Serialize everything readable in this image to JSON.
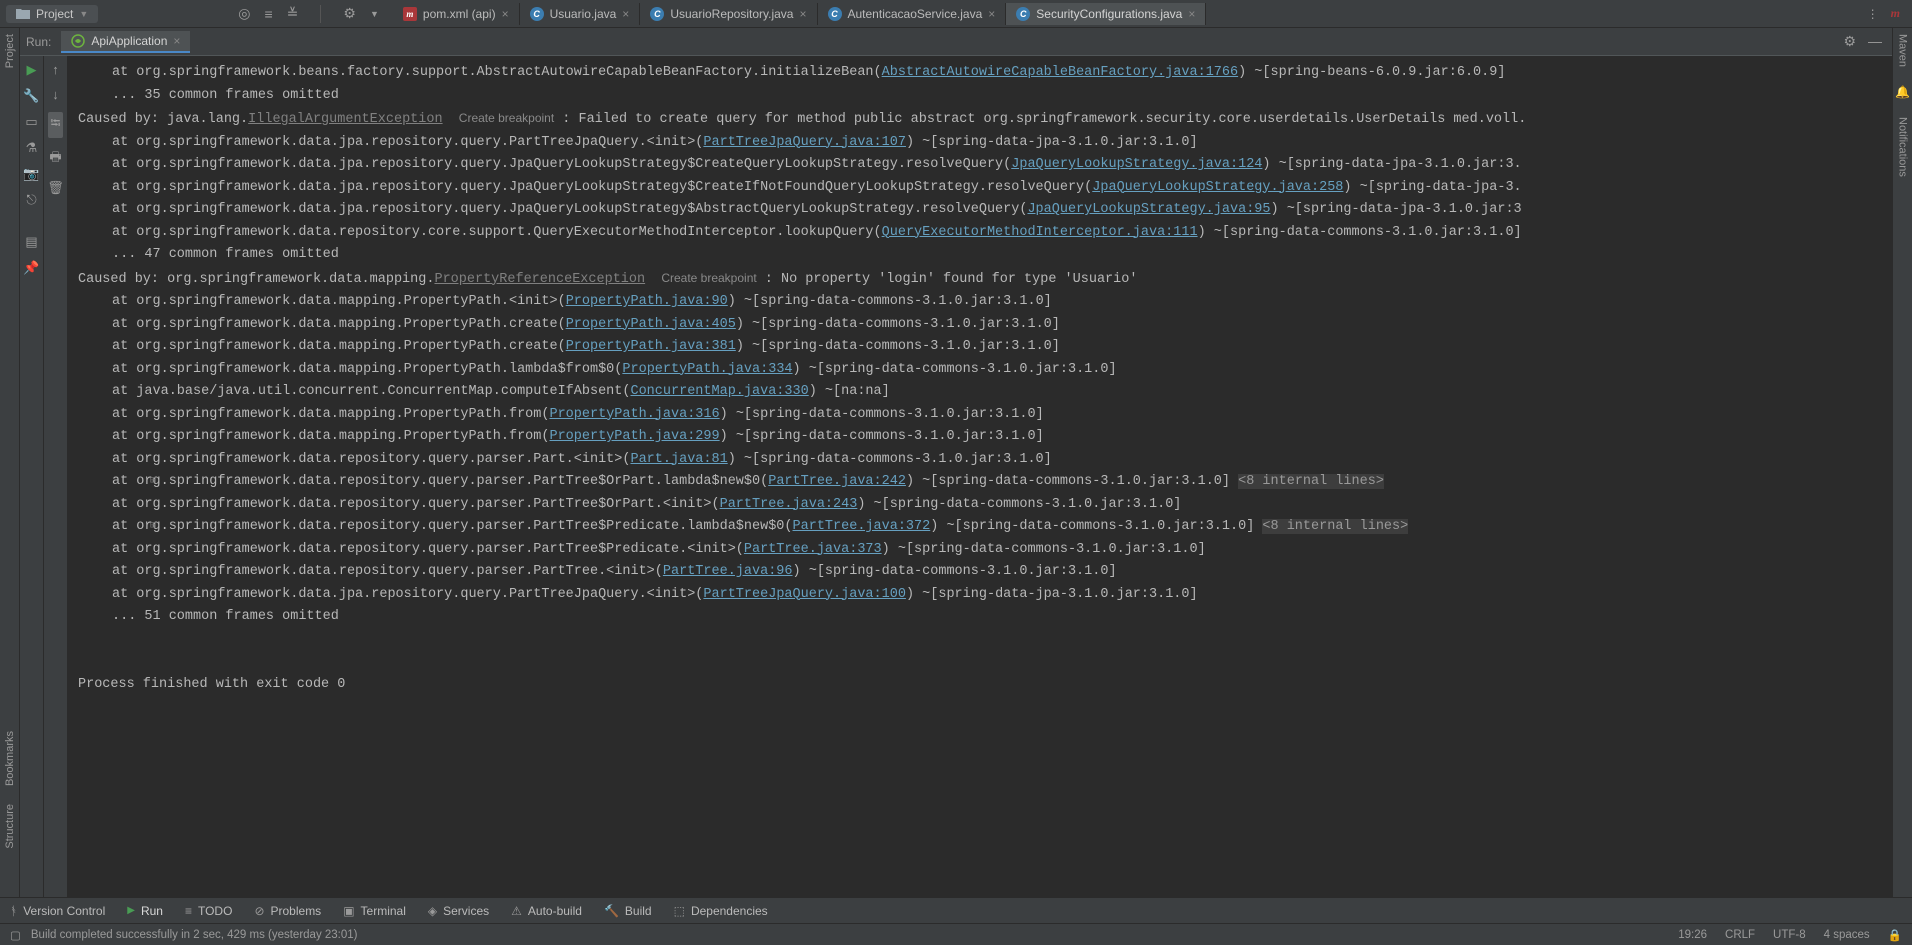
{
  "topbar": {
    "project_label": "Project"
  },
  "editor_tabs": [
    {
      "label": "pom.xml (api)",
      "icon": "m"
    },
    {
      "label": "Usuario.java",
      "icon": "c"
    },
    {
      "label": "UsuarioRepository.java",
      "icon": "c"
    },
    {
      "label": "AutenticacaoService.java",
      "icon": "c"
    },
    {
      "label": "SecurityConfigurations.java",
      "icon": "c",
      "active": true
    }
  ],
  "left_tool": [
    "Project"
  ],
  "left_tool_bottom": [
    "Bookmarks",
    "Structure"
  ],
  "right_tool": [
    "Maven",
    "Notifications"
  ],
  "run": {
    "label": "Run:",
    "tab": "ApiApplication"
  },
  "console_lines": [
    {
      "t": "at",
      "pre": "at org.springframework.beans.factory.support.AbstractAutowireCapableBeanFactory.initializeBean(",
      "link": "AbstractAutowireCapableBeanFactory.java:1766",
      "post": ") ~[spring-beans-6.0.9.jar:6.0.9]"
    },
    {
      "t": "dots",
      "text": "... 35 common frames omitted"
    },
    {
      "t": "caused",
      "pre": "Caused by: java.lang.",
      "ex": "IllegalArgumentException",
      "bp": "Create breakpoint",
      "post": " : Failed to create query for method public abstract org.springframework.security.core.userdetails.UserDetails med.voll."
    },
    {
      "t": "at",
      "pre": "at org.springframework.data.jpa.repository.query.PartTreeJpaQuery.<init>(",
      "link": "PartTreeJpaQuery.java:107",
      "post": ") ~[spring-data-jpa-3.1.0.jar:3.1.0]"
    },
    {
      "t": "at",
      "pre": "at org.springframework.data.jpa.repository.query.JpaQueryLookupStrategy$CreateQueryLookupStrategy.resolveQuery(",
      "link": "JpaQueryLookupStrategy.java:124",
      "post": ") ~[spring-data-jpa-3.1.0.jar:3."
    },
    {
      "t": "at",
      "pre": "at org.springframework.data.jpa.repository.query.JpaQueryLookupStrategy$CreateIfNotFoundQueryLookupStrategy.resolveQuery(",
      "link": "JpaQueryLookupStrategy.java:258",
      "post": ") ~[spring-data-jpa-3."
    },
    {
      "t": "at",
      "pre": "at org.springframework.data.jpa.repository.query.JpaQueryLookupStrategy$AbstractQueryLookupStrategy.resolveQuery(",
      "link": "JpaQueryLookupStrategy.java:95",
      "post": ") ~[spring-data-jpa-3.1.0.jar:3"
    },
    {
      "t": "at",
      "pre": "at org.springframework.data.repository.core.support.QueryExecutorMethodInterceptor.lookupQuery(",
      "link": "QueryExecutorMethodInterceptor.java:111",
      "post": ") ~[spring-data-commons-3.1.0.jar:3.1.0]"
    },
    {
      "t": "dots",
      "text": "... 47 common frames omitted"
    },
    {
      "t": "caused",
      "pre": "Caused by: org.springframework.data.mapping.",
      "ex": "PropertyReferenceException",
      "bp": "Create breakpoint",
      "post": " : No property 'login' found for type 'Usuario'"
    },
    {
      "t": "at",
      "pre": "at org.springframework.data.mapping.PropertyPath.<init>(",
      "link": "PropertyPath.java:90",
      "post": ") ~[spring-data-commons-3.1.0.jar:3.1.0]"
    },
    {
      "t": "at",
      "pre": "at org.springframework.data.mapping.PropertyPath.create(",
      "link": "PropertyPath.java:405",
      "post": ") ~[spring-data-commons-3.1.0.jar:3.1.0]"
    },
    {
      "t": "at",
      "pre": "at org.springframework.data.mapping.PropertyPath.create(",
      "link": "PropertyPath.java:381",
      "post": ") ~[spring-data-commons-3.1.0.jar:3.1.0]"
    },
    {
      "t": "at",
      "pre": "at org.springframework.data.mapping.PropertyPath.lambda$from$0(",
      "link": "PropertyPath.java:334",
      "post": ") ~[spring-data-commons-3.1.0.jar:3.1.0]"
    },
    {
      "t": "at",
      "pre": "at java.base/java.util.concurrent.ConcurrentMap.computeIfAbsent(",
      "link": "ConcurrentMap.java:330",
      "post": ") ~[na:na]"
    },
    {
      "t": "at",
      "pre": "at org.springframework.data.mapping.PropertyPath.from(",
      "link": "PropertyPath.java:316",
      "post": ") ~[spring-data-commons-3.1.0.jar:3.1.0]"
    },
    {
      "t": "at",
      "pre": "at org.springframework.data.mapping.PropertyPath.from(",
      "link": "PropertyPath.java:299",
      "post": ") ~[spring-data-commons-3.1.0.jar:3.1.0]"
    },
    {
      "t": "at",
      "pre": "at org.springframework.data.repository.query.parser.Part.<init>(",
      "link": "Part.java:81",
      "post": ") ~[spring-data-commons-3.1.0.jar:3.1.0]"
    },
    {
      "t": "at",
      "fold": true,
      "pre": "at org.springframework.data.repository.query.parser.PartTree$OrPart.lambda$new$0(",
      "link": "PartTree.java:242",
      "post": ") ~[spring-data-commons-3.1.0.jar:3.1.0] ",
      "hl": "<8 internal lines>"
    },
    {
      "t": "at",
      "pre": "at org.springframework.data.repository.query.parser.PartTree$OrPart.<init>(",
      "link": "PartTree.java:243",
      "post": ") ~[spring-data-commons-3.1.0.jar:3.1.0]"
    },
    {
      "t": "at",
      "fold": true,
      "pre": "at org.springframework.data.repository.query.parser.PartTree$Predicate.lambda$new$0(",
      "link": "PartTree.java:372",
      "post": ") ~[spring-data-commons-3.1.0.jar:3.1.0] ",
      "hl": "<8 internal lines>"
    },
    {
      "t": "at",
      "pre": "at org.springframework.data.repository.query.parser.PartTree$Predicate.<init>(",
      "link": "PartTree.java:373",
      "post": ") ~[spring-data-commons-3.1.0.jar:3.1.0]"
    },
    {
      "t": "at",
      "pre": "at org.springframework.data.repository.query.parser.PartTree.<init>(",
      "link": "PartTree.java:96",
      "post": ") ~[spring-data-commons-3.1.0.jar:3.1.0]"
    },
    {
      "t": "at",
      "pre": "at org.springframework.data.jpa.repository.query.PartTreeJpaQuery.<init>(",
      "link": "PartTreeJpaQuery.java:100",
      "post": ") ~[spring-data-jpa-3.1.0.jar:3.1.0]"
    },
    {
      "t": "dots",
      "text": "... 51 common frames omitted"
    },
    {
      "t": "blank"
    },
    {
      "t": "blank"
    },
    {
      "t": "plain",
      "text": "Process finished with exit code 0"
    }
  ],
  "bottom": [
    {
      "label": "Version Control",
      "icon": "branch"
    },
    {
      "label": "Run",
      "icon": "play",
      "active": true
    },
    {
      "label": "TODO",
      "icon": "list"
    },
    {
      "label": "Problems",
      "icon": "warn"
    },
    {
      "label": "Terminal",
      "icon": "term"
    },
    {
      "label": "Services",
      "icon": "serv"
    },
    {
      "label": "Auto-build",
      "icon": "auto"
    },
    {
      "label": "Build",
      "icon": "hammer"
    },
    {
      "label": "Dependencies",
      "icon": "dep"
    }
  ],
  "status": {
    "msg": "Build completed successfully in 2 sec, 429 ms (yesterday 23:01)",
    "time": "19:26",
    "le": "CRLF",
    "enc": "UTF-8",
    "indent": "4 spaces"
  }
}
